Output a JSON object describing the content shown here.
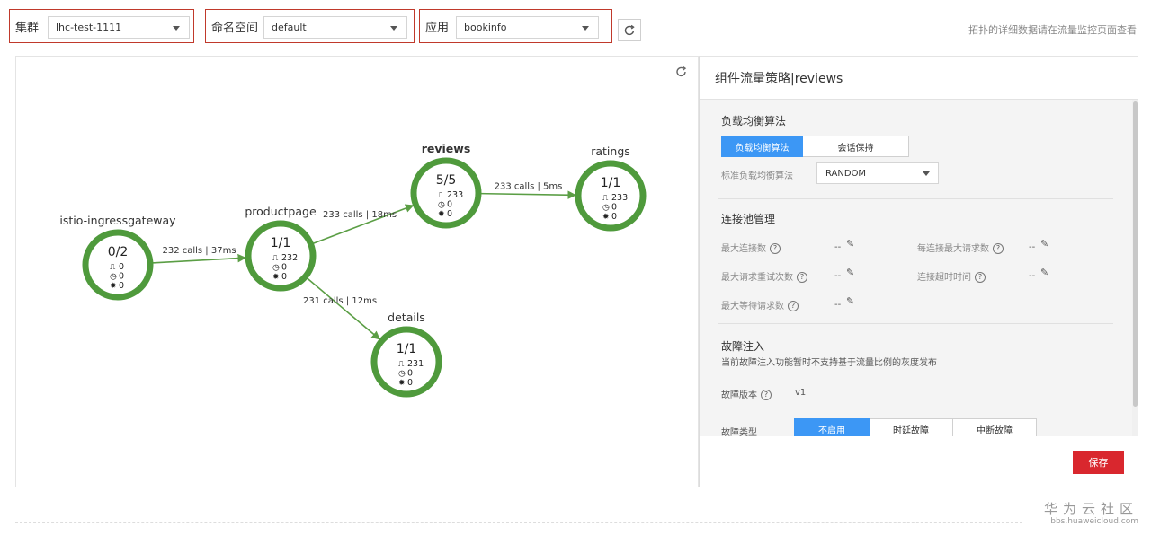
{
  "filters": {
    "cluster": {
      "label": "集群",
      "value": "lhc-test-1111"
    },
    "namespace": {
      "label": "命名空间",
      "value": "default"
    },
    "app": {
      "label": "应用",
      "value": "bookinfo"
    },
    "hint": "拓扑的详细数据请在流量监控页面查看"
  },
  "graph": {
    "nodes": [
      {
        "id": "gw",
        "name": "istio-ingressgateway",
        "ratio": "0/2",
        "requests": "0",
        "latency": "0",
        "errors": "0",
        "bold": false
      },
      {
        "id": "pp",
        "name": "productpage",
        "ratio": "1/1",
        "requests": "232",
        "latency": "0",
        "errors": "0",
        "bold": false
      },
      {
        "id": "rv",
        "name": "reviews",
        "ratio": "5/5",
        "requests": "233",
        "latency": "0",
        "errors": "0",
        "bold": true
      },
      {
        "id": "rt",
        "name": "ratings",
        "ratio": "1/1",
        "requests": "233",
        "latency": "0",
        "errors": "0",
        "bold": false
      },
      {
        "id": "dt",
        "name": "details",
        "ratio": "1/1",
        "requests": "231",
        "latency": "0",
        "errors": "0",
        "bold": false
      }
    ],
    "edges": [
      {
        "from": "gw",
        "to": "pp",
        "label": "232 calls | 37ms"
      },
      {
        "from": "pp",
        "to": "rv",
        "label": "233 calls | 18ms"
      },
      {
        "from": "rv",
        "to": "rt",
        "label": "233 calls | 5ms"
      },
      {
        "from": "pp",
        "to": "dt",
        "label": "231 calls | 12ms"
      }
    ]
  },
  "panel": {
    "title": "组件流量策略|reviews",
    "lb": {
      "title": "负载均衡算法",
      "tabs": [
        "负载均衡算法",
        "会话保持"
      ],
      "algo_label": "标准负载均衡算法",
      "algo_value": "RANDOM"
    },
    "pool": {
      "title": "连接池管理",
      "fields": [
        {
          "label": "最大连接数",
          "value": "--"
        },
        {
          "label": "每连接最大请求数",
          "value": "--"
        },
        {
          "label": "最大请求重试次数",
          "value": "--"
        },
        {
          "label": "连接超时时间",
          "value": "--"
        },
        {
          "label": "最大等待请求数",
          "value": "--"
        }
      ]
    },
    "fault": {
      "title": "故障注入",
      "desc": "当前故障注入功能暂时不支持基于流量比例的灰度发布",
      "version_label": "故障版本",
      "version_value": "v1",
      "type_label": "故障类型",
      "types": [
        "不启用",
        "时延故障",
        "中断故障"
      ]
    },
    "save": "保存"
  },
  "watermark": {
    "cn": "华为云社区",
    "url": "bbs.huaweicloud.com"
  },
  "colors": {
    "node": "#4f9a3c",
    "edge": "#5b9e45",
    "primary": "#3c97f5",
    "danger": "#d9272e"
  }
}
